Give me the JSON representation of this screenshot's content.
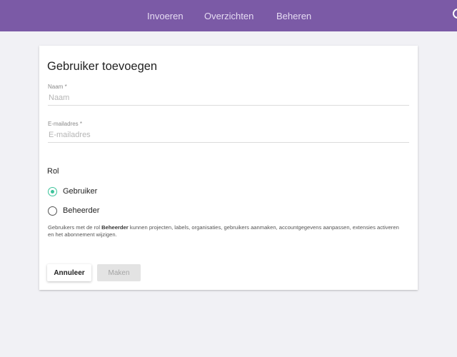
{
  "nav": {
    "items": [
      "Invoeren",
      "Overzichten",
      "Beheren"
    ]
  },
  "form": {
    "title": "Gebruiker toevoegen",
    "name_label": "Naam *",
    "name_placeholder": "Naam",
    "name_value": "",
    "email_label": "E-mailadres *",
    "email_placeholder": "E-mailadres",
    "email_value": "",
    "role_heading": "Rol",
    "roles": [
      {
        "label": "Gebruiker",
        "checked": true
      },
      {
        "label": "Beheerder",
        "checked": false
      }
    ],
    "help_prefix": "Gebruikers met de rol ",
    "help_bold": "Beheerder",
    "help_suffix": " kunnen projecten, labels, organisaties, gebruikers aanmaken, accountgegevens aanpassen, extensies activeren en het abonnement wijzigen.",
    "cancel_label": "Annuleer",
    "create_label": "Maken"
  },
  "colors": {
    "topbar": "#7b5aa6",
    "accent": "#3cc39a",
    "background": "#f1f1f5"
  }
}
